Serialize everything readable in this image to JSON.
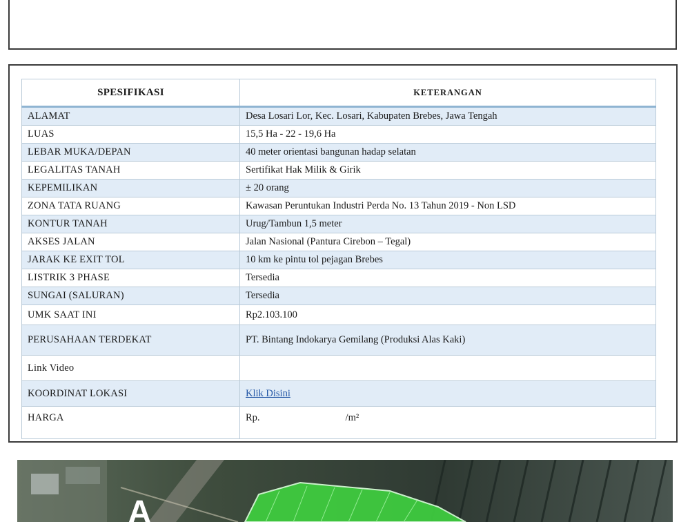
{
  "table": {
    "header": {
      "col1": "SPESIFIKASI",
      "col2": "KETERANGAN"
    },
    "rows": [
      {
        "label": "ALAMAT",
        "value": "Desa Losari Lor, Kec. Losari, Kabupaten Brebes, Jawa Tengah"
      },
      {
        "label": "LUAS",
        "value": "15,5 Ha - 22 - 19,6 Ha"
      },
      {
        "label": "LEBAR MUKA/DEPAN",
        "value": "40 meter orientasi bangunan hadap selatan"
      },
      {
        "label": "LEGALITAS TANAH",
        "value": "Sertifikat Hak Milik & Girik"
      },
      {
        "label": "KEPEMILIKAN",
        "value": "± 20 orang"
      },
      {
        "label": "ZONA TATA RUANG",
        "value": "Kawasan Peruntukan Industri Perda No. 13 Tahun 2019 - Non LSD"
      },
      {
        "label": "KONTUR TANAH",
        "value": "Urug/Tambun 1,5 meter"
      },
      {
        "label": "AKSES JALAN",
        "value": "Jalan Nasional (Pantura Cirebon – Tegal)"
      },
      {
        "label": "JARAK KE EXIT TOL",
        "value": "10 km ke pintu tol pejagan Brebes"
      },
      {
        "label": "LISTRIK 3 PHASE",
        "value": "Tersedia"
      },
      {
        "label": "SUNGAI (SALURAN)",
        "value": "Tersedia"
      },
      {
        "label": "UMK SAAT INI",
        "value": "Rp2.103.100"
      },
      {
        "label": "PERUSAHAAN TERDEKAT",
        "value": "PT. Bintang Indokarya Gemilang (Produksi Alas Kaki)"
      },
      {
        "label": "Link Video",
        "value": ""
      },
      {
        "label": "KOORDINAT LOKASI",
        "value": "Klik Disini"
      },
      {
        "label": "HARGA",
        "price_prefix": "Rp.",
        "price_unit": "/m²"
      }
    ]
  },
  "map": {
    "marker_letter": "A"
  },
  "colors": {
    "row_shade": "#e1ecf7",
    "header_rule": "#8fb4d2",
    "link": "#2457a6",
    "parcel": "#3fcf3f"
  }
}
